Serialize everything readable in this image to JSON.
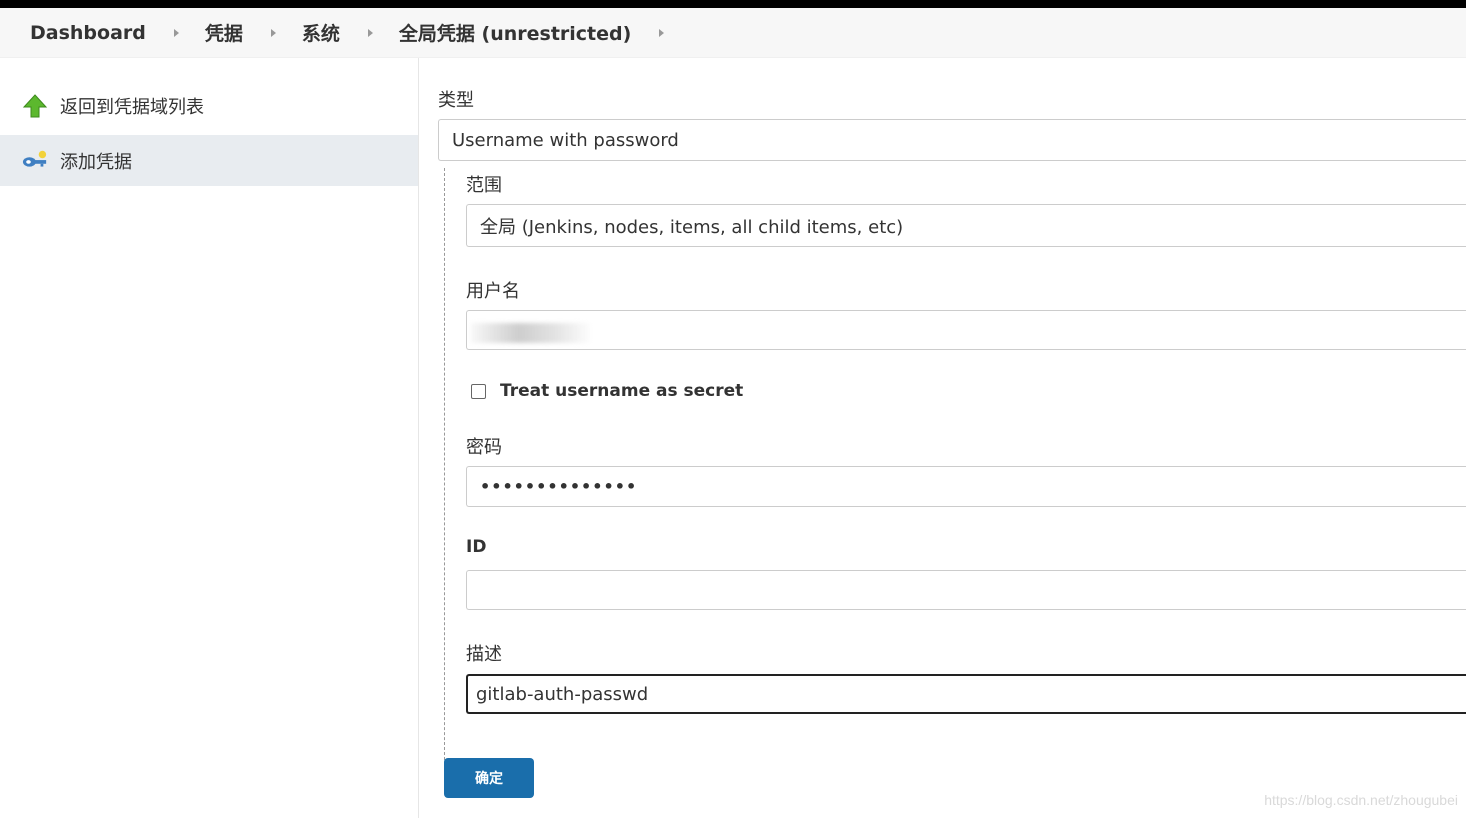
{
  "breadcrumb": {
    "items": [
      "Dashboard",
      "凭据",
      "系统",
      "全局凭据 (unrestricted)"
    ]
  },
  "sidebar": {
    "items": [
      {
        "label": "返回到凭据域列表",
        "icon": "up-arrow-icon"
      },
      {
        "label": "添加凭据",
        "icon": "key-icon"
      }
    ]
  },
  "form": {
    "kind_label": "类型",
    "kind_value": "Username with password",
    "scope_label": "范围",
    "scope_value": "全局 (Jenkins, nodes, items, all child items, etc)",
    "username_label": "用户名",
    "username_value": "",
    "treat_secret_label": "Treat username as secret",
    "password_label": "密码",
    "password_value": "••••••••••••••",
    "id_label": "ID",
    "id_value": "",
    "description_label": "描述",
    "description_value": "gitlab-auth-passwd",
    "submit_label": "确定"
  },
  "watermark": "https://blog.csdn.net/zhougubei",
  "colors": {
    "primary_button": "#1a6eab",
    "active_sidebar": "#e8ecf0",
    "icon_green": "#5cb82e",
    "icon_blue": "#3f7fc2"
  }
}
